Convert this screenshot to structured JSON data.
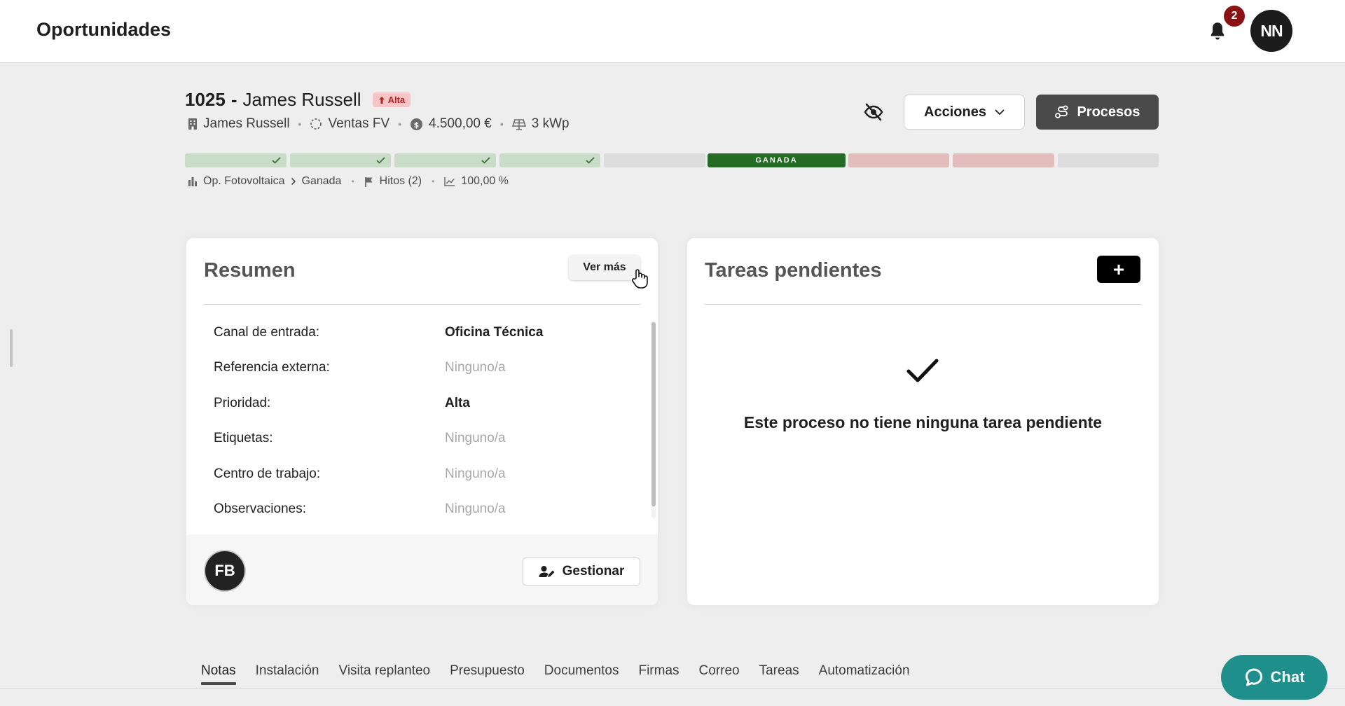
{
  "header": {
    "title": "Oportunidades",
    "notification_count": "2",
    "user_initials": "NN"
  },
  "opportunity": {
    "number": "1025",
    "separator": "-",
    "name": "James Russell",
    "priority_badge": "Alta",
    "meta": {
      "client": "James Russell",
      "pipeline": "Ventas FV",
      "amount": "4.500,00 €",
      "power": "3 kWp"
    },
    "actions_label": "Acciones",
    "processes_label": "Procesos"
  },
  "stages": {
    "completed_count": 4,
    "current_label": "GANADA",
    "lost_count": 2
  },
  "breadcrumb": {
    "process": "Op. Fotovoltaica",
    "stage": "Ganada",
    "milestones": "Hitos (2)",
    "probability": "100,00 %"
  },
  "resumen": {
    "title": "Resumen",
    "see_more": "Ver más",
    "fields": [
      {
        "label": "Canal de entrada:",
        "value": "Oficina Técnica"
      },
      {
        "label": "Referencia externa:",
        "value": "Ninguno/a"
      },
      {
        "label": "Prioridad:",
        "value": "Alta"
      },
      {
        "label": "Etiquetas:",
        "value": "Ninguno/a"
      },
      {
        "label": "Centro de trabajo:",
        "value": "Ninguno/a"
      },
      {
        "label": "Observaciones:",
        "value": "Ninguno/a"
      }
    ],
    "assignee_initials": "FB",
    "manage_label": "Gestionar"
  },
  "tareas": {
    "title": "Tareas pendientes",
    "add_label": "+",
    "empty_message": "Este proceso no tiene ninguna tarea pendiente"
  },
  "tabs": [
    {
      "label": "Notas",
      "active": true
    },
    {
      "label": "Instalación"
    },
    {
      "label": "Visita replanteo"
    },
    {
      "label": "Presupuesto"
    },
    {
      "label": "Documentos"
    },
    {
      "label": "Firmas"
    },
    {
      "label": "Correo"
    },
    {
      "label": "Tareas"
    },
    {
      "label": "Automatización"
    }
  ],
  "chat": {
    "label": "Chat"
  },
  "colors": {
    "won_stage": "#266b24",
    "completed_stage": "#c9dcc7",
    "lost_stage": "#e3bcbc",
    "pending_stage": "#dcdcdc",
    "notification_badge": "#8b1212",
    "chat_button": "#1e8f8b",
    "priority_badge_bg": "#f6c5c5",
    "priority_badge_text": "#b42121"
  },
  "icons": {
    "bell": "bell-icon",
    "eye_off": "eye-off-icon",
    "chevron": "chevron-down-icon",
    "processes": "route-icon",
    "building": "building-icon",
    "pipeline": "dashed-circle-icon",
    "amount": "coin-icon",
    "power": "solar-panel-icon",
    "chart": "bar-chart-icon",
    "flag": "flag-icon",
    "trend": "trend-icon",
    "check": "check-icon",
    "manage": "user-edit-icon",
    "chat": "chat-bubble-icon"
  }
}
